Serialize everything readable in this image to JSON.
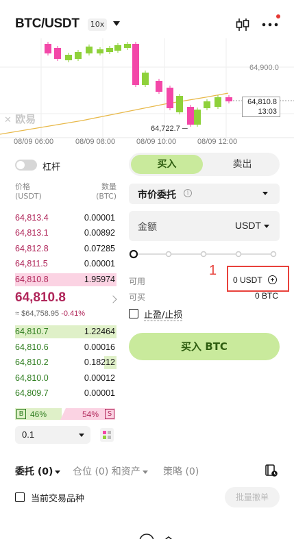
{
  "header": {
    "pair": "BTC/USDT",
    "leverage": "10x",
    "icons": [
      "chart-candlestick-icon",
      "more-icon"
    ]
  },
  "chart": {
    "y_labels": [
      "64,900.0"
    ],
    "current_price": "64,810.8",
    "countdown": "13:03",
    "low_marker": "64,722.7",
    "time_labels": [
      "08/09 06:00",
      "08/09 08:00",
      "08/09 10:00",
      "08/09 12:00"
    ],
    "watermark": "欧易",
    "colors": {
      "up": "#8ed13a",
      "down": "#f347a8",
      "ma": "#e8b94a"
    }
  },
  "orderbook": {
    "leverage_label": "杠杆",
    "price_header": [
      "价格",
      "(USDT)"
    ],
    "qty_header": [
      "数量",
      "(BTC)"
    ],
    "asks": [
      {
        "price": "64,813.4",
        "qty": "0.00001",
        "depth": 0.0
      },
      {
        "price": "64,813.1",
        "qty": "0.00892",
        "depth": 0.0
      },
      {
        "price": "64,812.8",
        "qty": "0.07285",
        "depth": 0.0
      },
      {
        "price": "64,811.5",
        "qty": "0.00001",
        "depth": 0.0
      },
      {
        "price": "64,810.8",
        "qty": "1.95974",
        "depth": 1.0
      }
    ],
    "mid": {
      "price": "64,810.8",
      "approx": "≈ $64,758.95",
      "change": "-0.41%"
    },
    "bids": [
      {
        "price": "64,810.7",
        "qty": "1.22464",
        "depth": 1.0
      },
      {
        "price": "64,810.6",
        "qty": "0.00016",
        "depth": 0.0
      },
      {
        "price": "64,810.2",
        "qty": "0.18212",
        "depth": 0.12
      },
      {
        "price": "64,810.0",
        "qty": "0.00012",
        "depth": 0.0
      },
      {
        "price": "64,809.7",
        "qty": "0.00001",
        "depth": 0.0
      }
    ],
    "ratio": {
      "b_tag": "B",
      "b_pct": "46%",
      "s_pct": "54%",
      "s_tag": "S"
    },
    "depth_value": "0.1"
  },
  "order_form": {
    "tab_buy": "买入",
    "tab_sell": "卖出",
    "order_type": "市价委托",
    "amount_label": "金额",
    "amount_unit": "USDT",
    "available_label": "可用",
    "available_value": "0 USDT",
    "buyable_label": "可买",
    "buyable_value": "0 BTC",
    "tpsl_label": "止盈/止损",
    "buy_button": "买入 BTC",
    "annotation_number": "1"
  },
  "bottom": {
    "tabs": [
      "委托 (0)",
      "仓位 (0) 和资产",
      "策略 (0)"
    ],
    "current_only_label": "当前交易品种",
    "batch_cancel": "批量撤单"
  }
}
